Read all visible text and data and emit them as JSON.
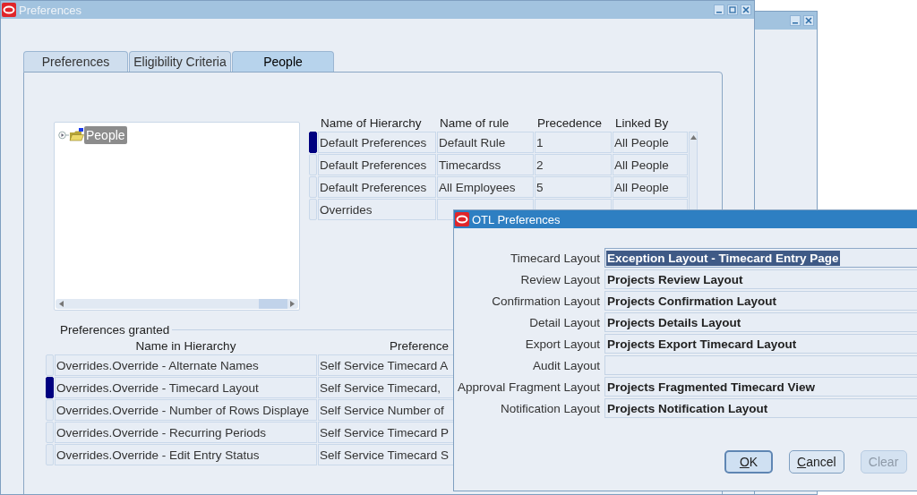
{
  "window": {
    "title": "Preferences"
  },
  "tabs": [
    {
      "label": "Preferences",
      "selected": false
    },
    {
      "label": "Eligibility Criteria",
      "selected": false
    },
    {
      "label": "People",
      "selected": true
    }
  ],
  "tree": {
    "items": [
      {
        "label": "People",
        "selected": true,
        "expanded": false
      }
    ]
  },
  "hierarchy_table": {
    "columns": [
      "Name of Hierarchy",
      "Name of rule",
      "Precedence",
      "Linked By"
    ],
    "rows": [
      {
        "selected": true,
        "cells": [
          "Default Preferences",
          "Default Rule",
          "1",
          "All People"
        ]
      },
      {
        "selected": false,
        "cells": [
          "Default Preferences",
          "Timecardss",
          "2",
          "All People"
        ]
      },
      {
        "selected": false,
        "cells": [
          "Default Preferences",
          "All Employees",
          "5",
          "All People"
        ]
      },
      {
        "selected": false,
        "cells": [
          "Overrides"
        ]
      }
    ]
  },
  "preferences_granted": {
    "title": "Preferences granted",
    "columns": [
      "Name in Hierarchy",
      "Preference"
    ],
    "rows": [
      {
        "selected": false,
        "cells": [
          "Overrides.Override - Alternate Names",
          "Self Service Timecard A"
        ]
      },
      {
        "selected": true,
        "cells": [
          "Overrides.Override - Timecard Layout",
          "Self Service Timecard,"
        ]
      },
      {
        "selected": false,
        "cells": [
          "Overrides.Override - Number of Rows Displaye",
          "Self Service Number of"
        ]
      },
      {
        "selected": false,
        "cells": [
          "Overrides.Override - Recurring Periods",
          "Self Service Timecard P"
        ]
      },
      {
        "selected": false,
        "cells": [
          "Overrides.Override - Edit Entry Status",
          "Self Service Timecard S"
        ]
      }
    ]
  },
  "dialog": {
    "title": "OTL Preferences",
    "fields": [
      {
        "label": "Timecard Layout",
        "value": "Exception Layout - Timecard Entry Page",
        "selected": true
      },
      {
        "label": "Review Layout",
        "value": "Projects Review Layout",
        "selected": false
      },
      {
        "label": "Confirmation Layout",
        "value": "Projects Confirmation Layout",
        "selected": false
      },
      {
        "label": "Detail Layout",
        "value": "Projects Details Layout",
        "selected": false
      },
      {
        "label": "Export Layout",
        "value": "Projects Export Timecard Layout",
        "selected": false
      },
      {
        "label": "Audit Layout",
        "selected": false
      },
      {
        "label": "Approval Fragment Layout",
        "value": "Projects Fragmented Timecard View",
        "selected": false
      },
      {
        "label": "Notification Layout",
        "value": "Projects Notification Layout",
        "selected": false
      }
    ],
    "buttons": [
      {
        "label": "OK",
        "default": true,
        "disabled": false,
        "mnemonic": true
      },
      {
        "label": "Cancel",
        "default": false,
        "disabled": false,
        "mnemonic": true
      },
      {
        "label": "Clear",
        "default": false,
        "disabled": true,
        "mnemonic": false
      }
    ]
  }
}
